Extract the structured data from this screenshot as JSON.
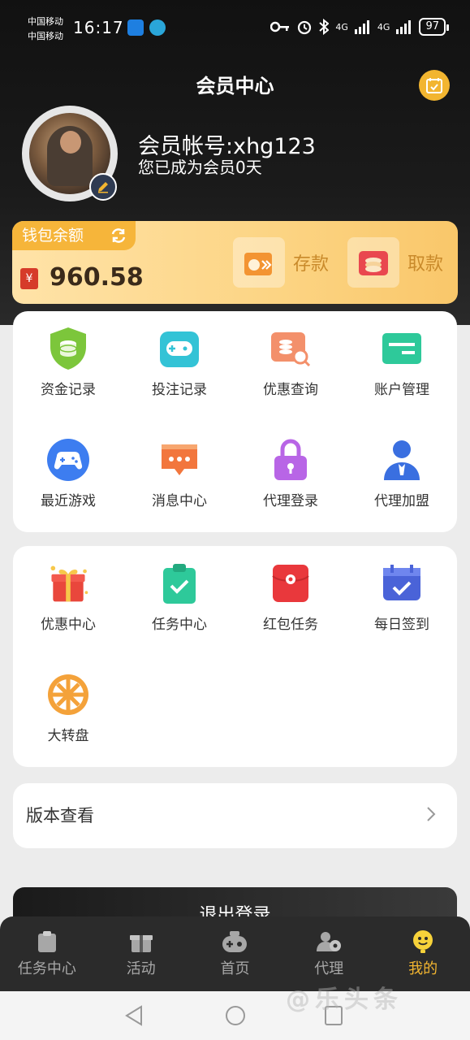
{
  "status_bar": {
    "carrier1": "中国移动",
    "carrier2": "中国移动",
    "time": "16:17",
    "network1": "4G",
    "network2": "4G",
    "battery": "97"
  },
  "header": {
    "title": "会员中心"
  },
  "profile": {
    "account": "会员帐号:xhg123",
    "member_days": "您已成为会员0天"
  },
  "wallet": {
    "tab_label": "钱包余额",
    "currency_symbol": "¥",
    "balance": "960.58",
    "deposit_label": "存款",
    "withdraw_label": "取款"
  },
  "grid1": [
    {
      "label": "资金记录",
      "icon": "fund-record-icon"
    },
    {
      "label": "投注记录",
      "icon": "bet-record-icon"
    },
    {
      "label": "优惠查询",
      "icon": "promo-query-icon"
    },
    {
      "label": "账户管理",
      "icon": "account-manage-icon"
    },
    {
      "label": "最近游戏",
      "icon": "gamepad-icon"
    },
    {
      "label": "消息中心",
      "icon": "message-icon"
    },
    {
      "label": "代理登录",
      "icon": "lock-icon"
    },
    {
      "label": "代理加盟",
      "icon": "agent-join-icon"
    }
  ],
  "grid2": [
    {
      "label": "优惠中心",
      "icon": "gift-icon"
    },
    {
      "label": "任务中心",
      "icon": "task-clipboard-icon"
    },
    {
      "label": "红包任务",
      "icon": "red-envelope-icon"
    },
    {
      "label": "每日签到",
      "icon": "calendar-check-icon"
    },
    {
      "label": "大转盘",
      "icon": "wheel-icon"
    }
  ],
  "version": {
    "label": "版本查看"
  },
  "logout": {
    "label": "退出登录"
  },
  "tabbar": [
    {
      "label": "任务中心",
      "icon": "task-icon"
    },
    {
      "label": "活动",
      "icon": "gift-box-icon"
    },
    {
      "label": "首页",
      "icon": "game-controller-icon"
    },
    {
      "label": "代理",
      "icon": "agent-icon"
    },
    {
      "label": "我的",
      "icon": "smiley-icon"
    }
  ],
  "colors": {
    "accent": "#f2b530",
    "wallet_text": "#c98a2b",
    "tab_inactive": "#a7a7a7"
  },
  "watermark": "@乐头条"
}
